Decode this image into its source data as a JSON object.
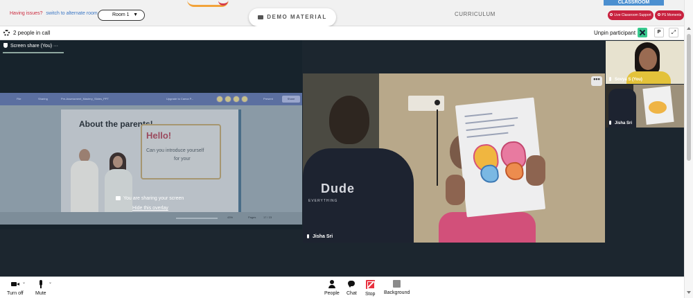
{
  "header": {
    "issues_label": "Having issues?",
    "alternate_link": "switch to alternate room",
    "room_select": "Room 1",
    "demo_material_button": "DEMO MATERIAL",
    "curriculum_tab": "CURRICULUM",
    "classroom_banner": "CLASSROOM",
    "live_support_button": "Live Classroom Support",
    "ps_moments_button": "PS Moments"
  },
  "call": {
    "people_in_call": "2 people in call",
    "unpin_label": "Unpin participant",
    "pin_p_label": "P",
    "expand_label": "⤢"
  },
  "share": {
    "tab_label": "Screen share (You)",
    "tab_more": "···",
    "sharing_message": "You are sharing your screen",
    "hide_overlay_link": "Hide this overlay",
    "slide": {
      "title": "About the parents!",
      "hello": "Hello!",
      "intro_line1": "Can you introduce yourself",
      "intro_line2": "for your",
      "topbar_file": "File",
      "topbar_sharing": "Sharing",
      "topbar_doc": "Pre-Assessment_Mastery_Slides_PPT",
      "topbar_upgrade": "Upgrade to Canva P...",
      "topbar_present": "Present",
      "topbar_share": "Share",
      "zoom": "43%",
      "page_label": "Pages",
      "page_number": "17 / 23"
    }
  },
  "participants": {
    "main_name": "Jisha Sri",
    "main_more": "•••",
    "shirt_print": "Dude",
    "shirt_print_small": "EVERYTHING",
    "thumb1_name": "Sovya S (You)",
    "thumb2_name": "Jisha Sri"
  },
  "toolbar": {
    "camera_label": "Turn off",
    "mute_label": "Mute",
    "people_label": "People",
    "chat_label": "Chat",
    "stop_label": "Stop",
    "background_label": "Background"
  },
  "colors": {
    "support_red": "#c8223f",
    "stage_dark": "#1c262f",
    "accent_green": "#39c98e",
    "stop_red": "#e8313f"
  }
}
